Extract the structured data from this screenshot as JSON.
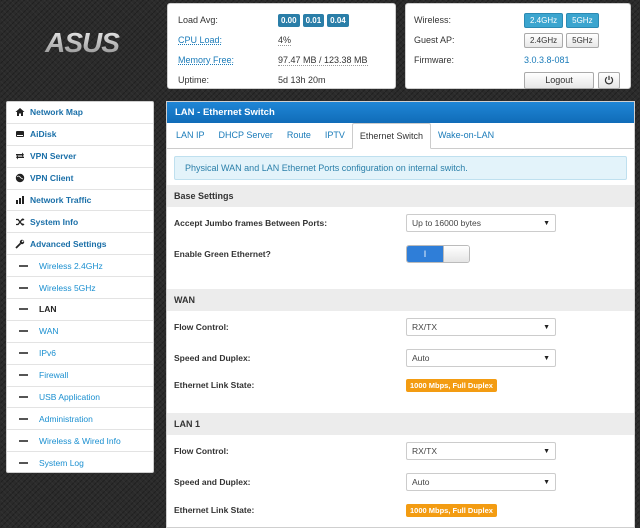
{
  "brand": {
    "logo_text": "ASUS"
  },
  "status": {
    "load_avg_label": "Load Avg:",
    "load_avg_values": [
      "0.00",
      "0.01",
      "0.04"
    ],
    "cpu_label": "CPU Load:",
    "cpu_value": "4%",
    "memory_label": "Memory Free:",
    "memory_value": "97.47 MB / 123.38 MB",
    "uptime_label": "Uptime:",
    "uptime_value": "5d 13h 20m"
  },
  "wireless": {
    "wireless_label": "Wireless:",
    "guest_label": "Guest AP:",
    "firmware_label": "Firmware:",
    "band_24": "2.4GHz",
    "band_5": "5GHz",
    "firmware_value": "3.0.3.8-081",
    "logout_label": "Logout",
    "power_icon": "power-icon"
  },
  "sidebar": {
    "items": [
      {
        "label": "Network Map",
        "icon": "home-icon"
      },
      {
        "label": "AiDisk",
        "icon": "disk-icon"
      },
      {
        "label": "VPN Server",
        "icon": "vpn-server-icon"
      },
      {
        "label": "VPN Client",
        "icon": "globe-icon"
      },
      {
        "label": "Network Traffic",
        "icon": "traffic-icon"
      },
      {
        "label": "System Info",
        "icon": "shuffle-icon"
      },
      {
        "label": "Advanced Settings",
        "icon": "wrench-icon"
      }
    ],
    "sub_items": [
      {
        "label": "Wireless 2.4GHz"
      },
      {
        "label": "Wireless 5GHz"
      },
      {
        "label": "LAN",
        "active": true
      },
      {
        "label": "WAN"
      },
      {
        "label": "IPv6"
      },
      {
        "label": "Firewall"
      },
      {
        "label": "USB Application"
      },
      {
        "label": "Administration"
      },
      {
        "label": "Wireless & Wired Info"
      },
      {
        "label": "System Log"
      }
    ]
  },
  "main": {
    "title": "LAN - Ethernet Switch",
    "tabs": [
      "LAN IP",
      "DHCP Server",
      "Route",
      "IPTV",
      "Ethernet Switch",
      "Wake-on-LAN"
    ],
    "active_tab": "Ethernet Switch",
    "info": "Physical WAN and LAN Ethernet Ports configuration on internal switch.",
    "base": {
      "heading": "Base Settings",
      "jumbo_label": "Accept Jumbo frames Between Ports:",
      "jumbo_value": "Up to 16000 bytes",
      "green_label": "Enable Green Ethernet?",
      "green_on_text": "I"
    },
    "wan": {
      "heading": "WAN",
      "flow_label": "Flow Control:",
      "flow_value": "RX/TX",
      "speed_label": "Speed and Duplex:",
      "speed_value": "Auto",
      "link_label": "Ethernet Link State:",
      "link_value": "1000 Mbps, Full Duplex"
    },
    "lan1": {
      "heading": "LAN 1",
      "flow_label": "Flow Control:",
      "flow_value": "RX/TX",
      "speed_label": "Speed and Duplex:",
      "speed_value": "Auto",
      "link_label": "Ethernet Link State:",
      "link_value": "1000 Mbps, Full Duplex"
    }
  },
  "colors": {
    "accent_blue": "#1f86d6",
    "link_blue": "#1a7bb9",
    "status_orange": "#f39c12",
    "badge_blue": "#2a7ea8"
  }
}
